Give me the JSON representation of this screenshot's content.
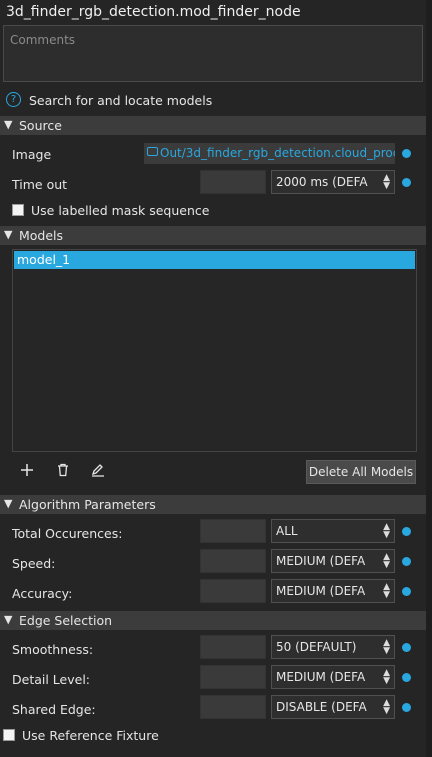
{
  "title": "3d_finder_rgb_detection.mod_finder_node",
  "comments": {
    "placeholder": "Comments"
  },
  "help": {
    "icon": "help-circle-icon",
    "text": "Search for and locate models"
  },
  "sections": {
    "source": "Source",
    "models": "Models",
    "algorithm": "Algorithm Parameters",
    "edge": "Edge Selection"
  },
  "source": {
    "image_label": "Image",
    "image_value": "Out/3d_finder_rgb_detection.cloud_proce",
    "timeout_label": "Time out",
    "timeout_value": "2000 ms (DEFA",
    "mask_label": "Use labelled mask sequence"
  },
  "models": {
    "items": [
      "model_1"
    ],
    "delete_all": "Delete All Models",
    "add_icon": "plus-icon",
    "delete_icon": "trash-icon",
    "edit_icon": "pencil-icon"
  },
  "algorithm": {
    "total_label": "Total Occurences:",
    "total_value": "ALL",
    "speed_label": "Speed:",
    "speed_value": "MEDIUM (DEFA",
    "accuracy_label": "Accuracy:",
    "accuracy_value": "MEDIUM (DEFA"
  },
  "edge": {
    "smooth_label": "Smoothness:",
    "smooth_value": "50 (DEFAULT)",
    "detail_label": "Detail Level:",
    "detail_value": "MEDIUM (DEFA",
    "shared_label": "Shared Edge:",
    "shared_value": "DISABLE (DEFA",
    "fixture_label": "Use Reference Fixture"
  },
  "colors": {
    "accent": "#29a8e0",
    "background": "#252526",
    "section": "#3c3c3c"
  }
}
